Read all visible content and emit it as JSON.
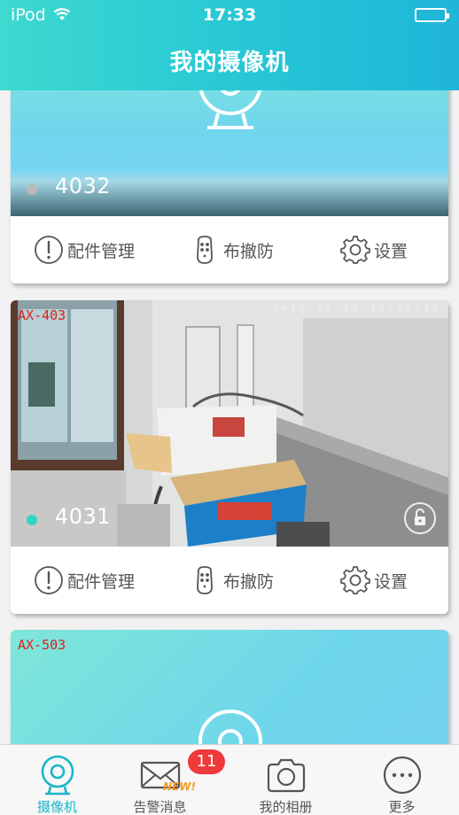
{
  "status_bar": {
    "carrier": "iPod",
    "time": "17:33"
  },
  "header": {
    "title": "我的摄像机"
  },
  "cameras": [
    {
      "name": "4032",
      "status_color": "#b9b9b9",
      "model": "",
      "actions": [
        "配件管理",
        "布撤防",
        "设置"
      ]
    },
    {
      "name": "4031",
      "status_color": "#2fd6c3",
      "model": "AX-403",
      "osd_time": "2015 10 19 17:32:39",
      "actions": [
        "配件管理",
        "布撤防",
        "设置"
      ]
    },
    {
      "name": "",
      "model": "AX-503"
    }
  ],
  "tabbar": {
    "tabs": [
      {
        "label": "摄像机",
        "icon": "camera-tab-icon",
        "active": true
      },
      {
        "label": "告警消息",
        "icon": "mail-icon",
        "active": false
      },
      {
        "label": "我的相册",
        "icon": "photo-camera-icon",
        "active": false
      },
      {
        "label": "更多",
        "icon": "more-icon",
        "active": false
      }
    ],
    "badge_count": "11",
    "new_label": "NEW!"
  },
  "colors": {
    "accent": "#19b6c9",
    "header_start": "#3ed9cf",
    "header_end": "#1fb5d8",
    "badge": "#f0393a",
    "model_tag": "#d8231c"
  }
}
